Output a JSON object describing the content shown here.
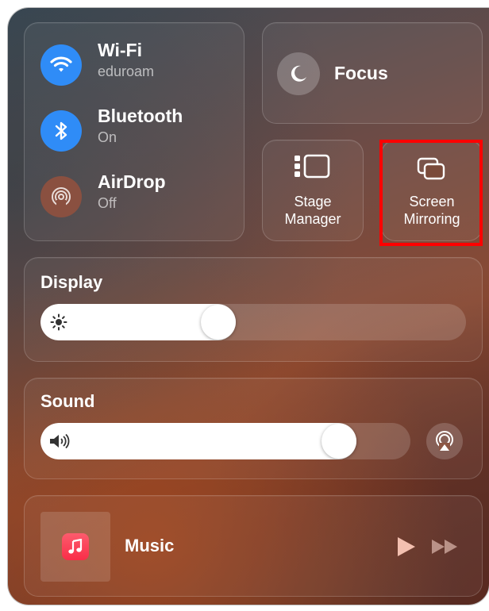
{
  "network": {
    "items": [
      {
        "title": "Wi-Fi",
        "subtitle": "eduroam",
        "icon": "wifi-icon",
        "state": "on"
      },
      {
        "title": "Bluetooth",
        "subtitle": "On",
        "icon": "bluetooth-icon",
        "state": "on"
      },
      {
        "title": "AirDrop",
        "subtitle": "Off",
        "icon": "airdrop-icon",
        "state": "off"
      }
    ]
  },
  "focus": {
    "label": "Focus",
    "icon": "moon-icon"
  },
  "stage_manager": {
    "label_line1": "Stage",
    "label_line2": "Manager",
    "icon": "stage-manager-icon"
  },
  "screen_mirroring": {
    "label_line1": "Screen",
    "label_line2": "Mirroring",
    "icon": "screen-mirroring-icon",
    "highlighted": true
  },
  "display": {
    "title": "Display",
    "brightness": 0.41,
    "icon": "sun-icon"
  },
  "sound": {
    "title": "Sound",
    "volume": 0.84,
    "icon": "speaker-icon",
    "airplay_icon": "airplay-audio-icon"
  },
  "music": {
    "label": "Music",
    "app_icon": "music-app-icon",
    "play_icon": "play-icon",
    "next_icon": "fast-forward-icon"
  },
  "colors": {
    "accent_blue": "#2f8cf7",
    "airdrop_off": "#8a5040",
    "highlight_red": "#ff0000",
    "music_red": "#fa2d48"
  }
}
